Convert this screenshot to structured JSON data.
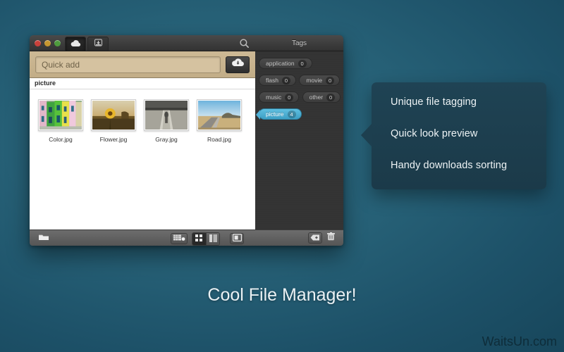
{
  "window": {
    "traffic_lights": [
      "close",
      "minimize",
      "zoom"
    ],
    "tabs": [
      {
        "name": "uploads-tab",
        "icon": "cloud-up-icon",
        "active": true
      },
      {
        "name": "downloads-tab",
        "icon": "download-tray-icon",
        "active": false
      }
    ],
    "search_icon": "search-icon"
  },
  "quick_add": {
    "placeholder": "Quick add",
    "value": "",
    "button_icon": "cloud-download-icon"
  },
  "file_list": {
    "group_header": "picture",
    "items": [
      {
        "name": "Color.jpg",
        "thumb": "colorful-houses"
      },
      {
        "name": "Flower.jpg",
        "thumb": "sunflower-field"
      },
      {
        "name": "Gray.jpg",
        "thumb": "gray-path"
      },
      {
        "name": "Road.jpg",
        "thumb": "desert-road"
      }
    ]
  },
  "bottom_toolbar": {
    "folder_icon": "folder-icon",
    "new_item_icon": "new-list-item-icon",
    "view_grid_icon": "grid-view-icon",
    "view_list_icon": "list-view-icon",
    "view_grid_active": true,
    "sidebar_toggle_icon": "panel-toggle-icon"
  },
  "tags_panel": {
    "title": "Tags",
    "tags": [
      {
        "label": "application",
        "count": "0",
        "selected": false
      },
      {
        "label": "flash",
        "count": "0",
        "selected": false
      },
      {
        "label": "movie",
        "count": "0",
        "selected": false
      },
      {
        "label": "music",
        "count": "0",
        "selected": false
      },
      {
        "label": "other",
        "count": "0",
        "selected": false
      },
      {
        "label": "picture",
        "count": "4",
        "selected": true
      }
    ],
    "add_tag_icon": "add-tag-icon",
    "delete_tag_icon": "trash-icon"
  },
  "callout": {
    "lines": [
      "Unique file tagging",
      "Quick look preview",
      "Handy downloads sorting"
    ]
  },
  "caption": "Cool File Manager!",
  "watermark": "WaitsUn.com",
  "colors": {
    "background_teal": "#266076",
    "quickadd_tan": "#c8b28c",
    "selected_tag_blue": "#4fb0d6",
    "callout_navy": "#1f4354",
    "chrome_dark": "#343434"
  }
}
